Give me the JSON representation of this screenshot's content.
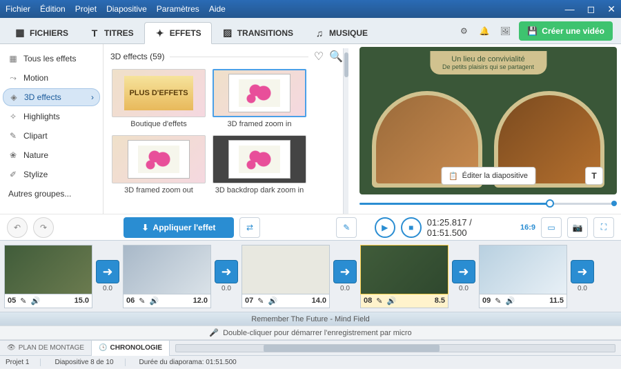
{
  "menu": {
    "file": "Fichier",
    "edit": "Édition",
    "project": "Projet",
    "slide": "Diapositive",
    "settings": "Paramètres",
    "help": "Aide"
  },
  "tabs": {
    "files": "FICHIERS",
    "titles": "TITRES",
    "effects": "EFFETS",
    "transitions": "TRANSITIONS",
    "music": "MUSIQUE"
  },
  "createBtn": "Créer une vidéo",
  "categories": {
    "all": "Tous les effets",
    "motion": "Motion",
    "3d": "3D effects",
    "highlights": "Highlights",
    "clipart": "Clipart",
    "nature": "Nature",
    "stylize": "Stylize",
    "other": "Autres groupes..."
  },
  "effects": {
    "header": "3D effects (59)",
    "shop": "PLUS D'EFFETS",
    "items": [
      "Boutique d'effets",
      "3D framed zoom in",
      "3D framed zoom out",
      "3D backdrop dark zoom in"
    ]
  },
  "preview": {
    "title1": "Un lieu de convivialité",
    "title2": "De petits plaisirs qui se partagent",
    "editBtn": "Éditer la diapositive"
  },
  "applyBtn": "Appliquer l'effet",
  "time": {
    "current": "01:25.817",
    "total": "01:51.500",
    "aspect": "16:9"
  },
  "slides": [
    {
      "num": "05",
      "dur": "15.0"
    },
    {
      "num": "06",
      "dur": "12.0"
    },
    {
      "num": "07",
      "dur": "14.0"
    },
    {
      "num": "08",
      "dur": "8.5"
    },
    {
      "num": "09",
      "dur": "11.5"
    }
  ],
  "transDur": "0.0",
  "audioLabel": "Remember The Future - Mind Field",
  "recLabel": "Double-cliquer pour démarrer l'enregistrement par micro",
  "btabs": {
    "plan": "PLAN DE MONTAGE",
    "chrono": "CHRONOLOGIE"
  },
  "status": {
    "proj": "Projet 1",
    "slide": "Diapositive 8 de 10",
    "dur": "Durée du diaporama: 01:51.500"
  }
}
